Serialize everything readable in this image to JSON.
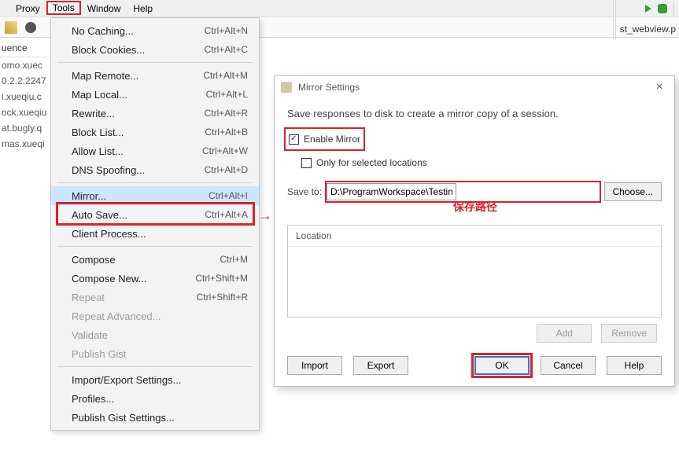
{
  "menubar": {
    "proxy": "Proxy",
    "tools": "Tools",
    "window": "Window",
    "help": "Help"
  },
  "filetab": {
    "prefix": "st_webview.p"
  },
  "side": {
    "header": "uence",
    "items": [
      "omo.xuec",
      "0.2.2:2247",
      "i.xueqiu.c",
      "ock.xueqiu",
      "at.bugly.q",
      "mas.xueqi"
    ]
  },
  "menu": {
    "no_caching": {
      "label": "No Caching...",
      "sc": "Ctrl+Alt+N"
    },
    "block_cookies": {
      "label": "Block Cookies...",
      "sc": "Ctrl+Alt+C"
    },
    "map_remote": {
      "label": "Map Remote...",
      "sc": "Ctrl+Alt+M"
    },
    "map_local": {
      "label": "Map Local...",
      "sc": "Ctrl+Alt+L"
    },
    "rewrite": {
      "label": "Rewrite...",
      "sc": "Ctrl+Alt+R"
    },
    "block_list": {
      "label": "Block List...",
      "sc": "Ctrl+Alt+B"
    },
    "allow_list": {
      "label": "Allow List...",
      "sc": "Ctrl+Alt+W"
    },
    "dns_spoof": {
      "label": "DNS Spoofing...",
      "sc": "Ctrl+Alt+D"
    },
    "mirror": {
      "label": "Mirror...",
      "sc": "Ctrl+Alt+I"
    },
    "auto_save": {
      "label": "Auto Save...",
      "sc": "Ctrl+Alt+A"
    },
    "client_process": {
      "label": "Client Process...",
      "sc": ""
    },
    "compose": {
      "label": "Compose",
      "sc": "Ctrl+M"
    },
    "compose_new": {
      "label": "Compose New...",
      "sc": "Ctrl+Shift+M"
    },
    "repeat": {
      "label": "Repeat",
      "sc": "Ctrl+Shift+R"
    },
    "repeat_adv": {
      "label": "Repeat Advanced...",
      "sc": ""
    },
    "validate": {
      "label": "Validate",
      "sc": ""
    },
    "publish_gist": {
      "label": "Publish Gist",
      "sc": ""
    },
    "import_export": {
      "label": "Import/Export Settings...",
      "sc": ""
    },
    "profiles": {
      "label": "Profiles...",
      "sc": ""
    },
    "publish_gist_set": {
      "label": "Publish Gist Settings...",
      "sc": ""
    }
  },
  "dialog": {
    "title": "Mirror Settings",
    "desc": "Save responses to disk to create a mirror copy of a session.",
    "enable": "Enable Mirror",
    "only_sel": "Only for selected locations",
    "save_to_lbl": "Save to:",
    "path": "D:\\ProgramWorkspace\\TestingDemo\\test_charles\\mirror",
    "choose": "Choose...",
    "loc_header": "Location",
    "add": "Add",
    "remove": "Remove",
    "import": "Import",
    "export": "Export",
    "ok": "OK",
    "cancel": "Cancel",
    "help": "Help"
  },
  "annot": {
    "save_path": "保存路径"
  }
}
